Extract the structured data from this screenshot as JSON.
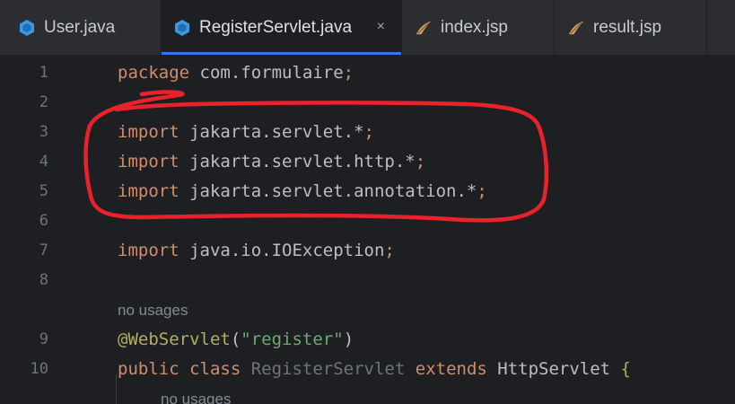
{
  "tabs": [
    {
      "label": "User.java",
      "icon": "java-class-icon"
    },
    {
      "label": "RegisterServlet.java",
      "icon": "java-class-icon",
      "active": true,
      "close": "×"
    },
    {
      "label": "index.jsp",
      "icon": "jsp-file-icon"
    },
    {
      "label": "result.jsp",
      "icon": "jsp-file-icon"
    }
  ],
  "code": {
    "l1": {
      "num": "1",
      "kw": "package",
      "rest": " com.formulaire",
      "semi": ";"
    },
    "l2": {
      "num": "2"
    },
    "l3": {
      "num": "3",
      "kw": "import",
      "rest": " jakarta.servlet.*",
      "semi": ";"
    },
    "l4": {
      "num": "4",
      "kw": "import",
      "rest": " jakarta.servlet.http.*",
      "semi": ";"
    },
    "l5": {
      "num": "5",
      "kw": "import",
      "rest": " jakarta.servlet.annotation.*",
      "semi": ";"
    },
    "l6": {
      "num": "6"
    },
    "l7": {
      "num": "7",
      "kw": "import",
      "rest": " java.io.IOException",
      "semi": ";"
    },
    "l8": {
      "num": "8"
    },
    "hint1": "no usages",
    "l9": {
      "num": "9",
      "ann": "@WebServlet",
      "open": "(",
      "str": "\"register\"",
      "close": ")"
    },
    "l10": {
      "num": "10",
      "kw1": "public",
      "kw2": " class",
      "name": " RegisterServlet",
      "kw3": " extends",
      "super": " HttpServlet",
      "brace": " {"
    },
    "hint2": "no usages"
  },
  "colors": {
    "annotation_stroke": "#e8222b",
    "active_tab_underline": "#3574f0"
  }
}
